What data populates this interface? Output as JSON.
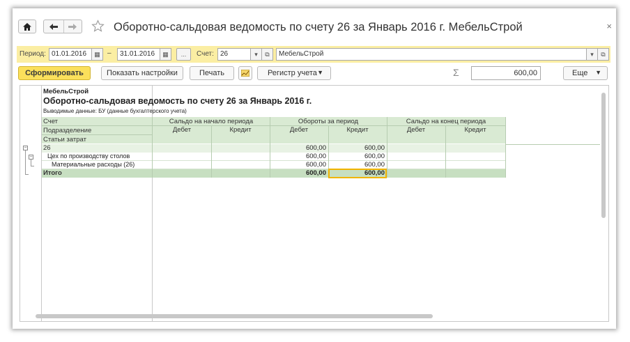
{
  "window": {
    "title": "Оборотно-сальдовая ведомость по счету 26 за Январь 2016 г. МебельСтрой",
    "close": "×",
    "home_icon": "house-icon",
    "back_icon": "arrow-left-icon",
    "forward_icon": "arrow-right-icon",
    "star_icon": "star-icon"
  },
  "period": {
    "label": "Период:",
    "from": "01.01.2016",
    "dash": "–",
    "to": "31.01.2016",
    "ellipsis": "...",
    "account_label": "Счет:",
    "account": "26",
    "org": "МебельСтрой"
  },
  "toolbar": {
    "generate": "Сформировать",
    "show_settings": "Показать настройки",
    "print": "Печать",
    "register": "Регистр учета",
    "sigma": "Σ",
    "sum": "600,00",
    "more": "Еще"
  },
  "report": {
    "company": "МебельСтрой",
    "title": "Оборотно-сальдовая ведомость по счету 26 за Январь 2016 г.",
    "data_label": "Выводимые данные:  БУ (данные бухгалтерского учета)",
    "col_account": "Счет",
    "col_division": "Подразделение",
    "col_cost": "Статьи затрат",
    "groups": [
      "Сальдо на начало периода",
      "Обороты за период",
      "Сальдо на конец периода"
    ],
    "debit": "Дебет",
    "credit": "Кредит",
    "rows": [
      {
        "name": "26",
        "debit_turn": "600,00",
        "credit_turn": "600,00"
      },
      {
        "name": "Цех по производству столов",
        "debit_turn": "600,00",
        "credit_turn": "600,00"
      },
      {
        "name": "Материальные расходы (26)",
        "debit_turn": "600,00",
        "credit_turn": "600,00"
      }
    ],
    "total": {
      "name": "Итого",
      "debit_turn": "600,00",
      "credit_turn": "600,00"
    }
  }
}
